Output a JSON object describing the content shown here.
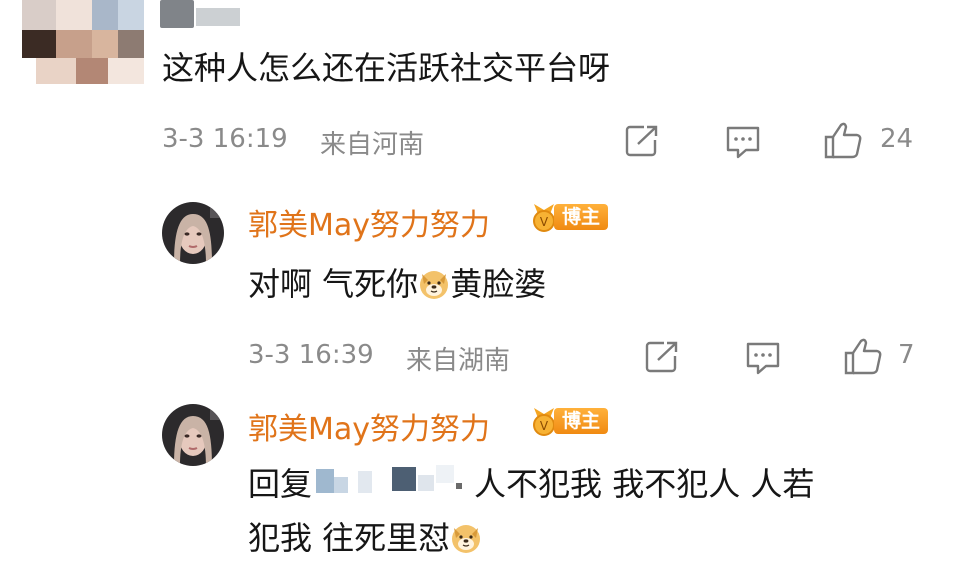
{
  "top_comment": {
    "text": "这种人怎么还在活跃社交平台呀",
    "timestamp": "3-3 16:19",
    "location": "来自河南",
    "like_count": "24"
  },
  "replies": [
    {
      "username": "郭美May努力努力",
      "badge_label": "博主",
      "text_before": "对啊 气死你",
      "text_after": "黄脸婆",
      "timestamp": "3-3 16:39",
      "location": "来自湖南",
      "like_count": "7"
    },
    {
      "username": "郭美May努力努力",
      "badge_label": "博主",
      "reply_prefix": "回复",
      "line1": "人不犯我 我不犯人 人若",
      "line2": "犯我 往死里怼"
    }
  ],
  "colors": {
    "username": "#e0741a",
    "meta": "#8a8a8a",
    "badge": "#f08a12"
  },
  "icons": [
    "share-icon",
    "comment-icon",
    "like-icon",
    "dog-emoji-icon",
    "medal-icon"
  ]
}
